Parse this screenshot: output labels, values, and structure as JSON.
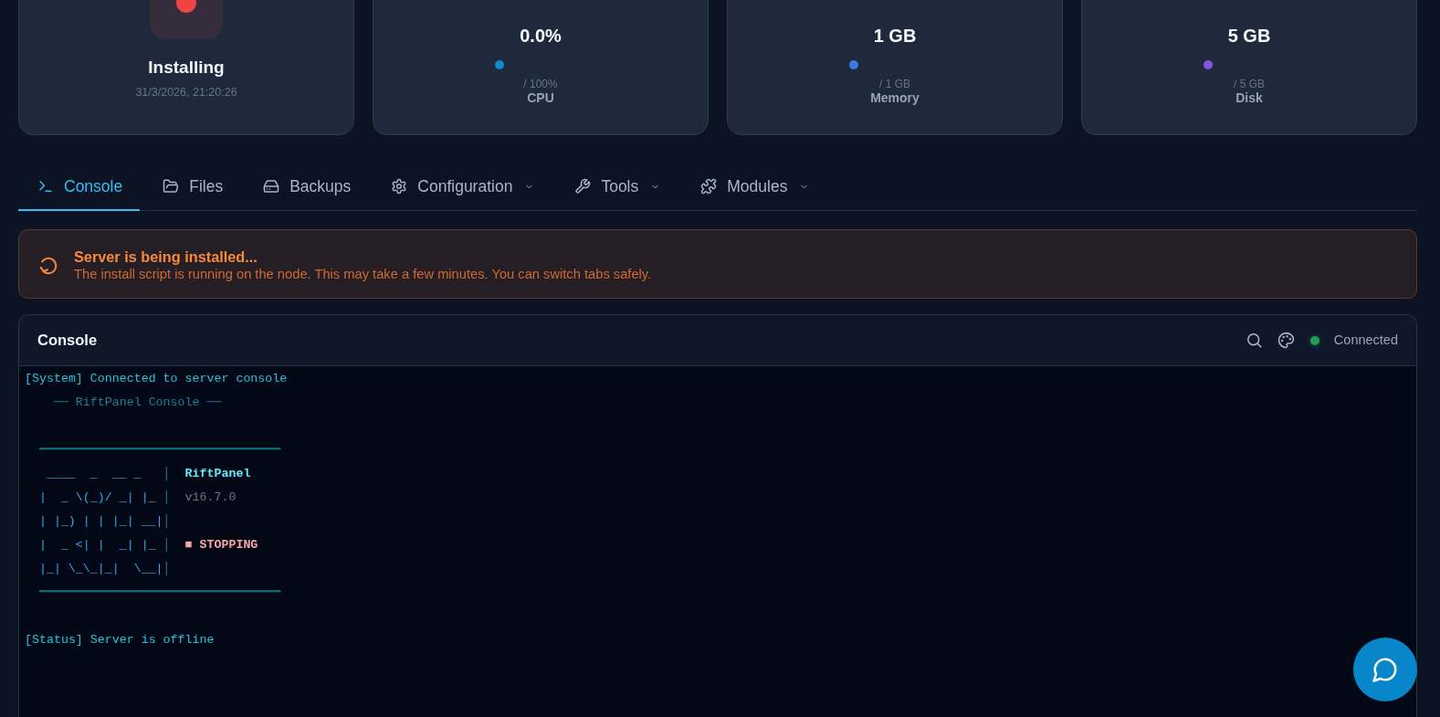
{
  "server": {
    "installing": true,
    "label": "Installing",
    "timestamp": "31/3/2026, 21:20:26"
  },
  "stats": [
    {
      "value": "0.0%",
      "limit": "/ 100%",
      "label": "CPU",
      "color": "#1088cc"
    },
    {
      "value": "1 GB",
      "limit": "/ 1 GB",
      "label": "Memory",
      "color": "#3b7ddd"
    },
    {
      "value": "5 GB",
      "limit": "/ 5 GB",
      "label": "Disk",
      "color": "#8456e0"
    }
  ],
  "tabs": [
    {
      "label": "Console",
      "selected": true,
      "dropdown": false
    },
    {
      "label": "Files",
      "selected": false,
      "dropdown": false
    },
    {
      "label": "Backups",
      "selected": false,
      "dropdown": false
    },
    {
      "label": "Configuration",
      "selected": false,
      "dropdown": true
    },
    {
      "label": "Tools",
      "selected": false,
      "dropdown": true
    },
    {
      "label": "Modules",
      "selected": false,
      "dropdown": true
    }
  ],
  "notice": {
    "title": "Server is being installed...",
    "message": "The install script is running on the node. This may take a few minutes. You can switch tabs safely."
  },
  "console": {
    "title": "Console",
    "connected": true,
    "connection_label": "Connected",
    "lines": [
      {
        "kind": "info",
        "text": "[System] Connected to server console"
      },
      {
        "kind": "header",
        "text": "── RiftPanel Console ──"
      },
      {
        "kind": "blank"
      },
      {
        "kind": "rule",
        "text": "━━━━━━━━━━━━━━━━━━━━━━━━━━━━━━━━━"
      },
      {
        "kind": "art",
        "art": " ____  _  __ _   ",
        "separator": "│",
        "info": {
          "kind": "name",
          "text": "RiftPanel"
        }
      },
      {
        "kind": "art",
        "art": "|  _ \\(_)/ _| |_ ",
        "separator": "│",
        "info": {
          "kind": "version",
          "text": "v16.7.0"
        }
      },
      {
        "kind": "art",
        "art": "| |_) | | |_| __|",
        "separator": "│"
      },
      {
        "kind": "art",
        "art": "|  _ <| |  _| |_ ",
        "separator": "│",
        "info": {
          "kind": "status",
          "text": "■ STOPPING"
        }
      },
      {
        "kind": "art",
        "art": "|_| \\_\\_|_|  \\__|",
        "separator": "│"
      },
      {
        "kind": "rule",
        "text": "━━━━━━━━━━━━━━━━━━━━━━━━━━━━━━━━━"
      },
      {
        "kind": "blank"
      },
      {
        "kind": "info",
        "text": "[Status] Server is offline"
      }
    ]
  }
}
